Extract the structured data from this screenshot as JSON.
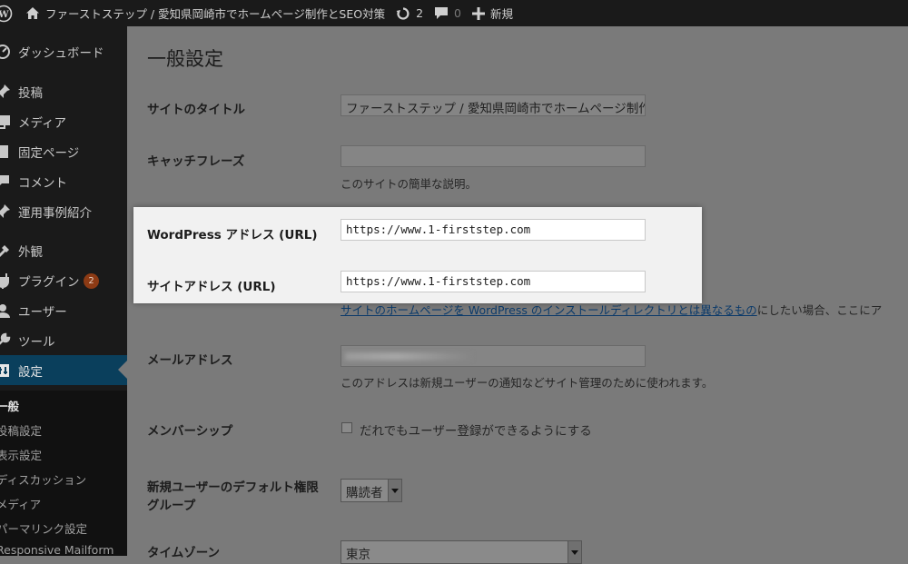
{
  "adminbar": {
    "site_name": "ファーストステップ / 愛知県岡崎市でホームページ制作とSEO対策",
    "updates_count": "2",
    "comments_count": "0",
    "new_label": "新規"
  },
  "sidebar": {
    "items": [
      {
        "label": "ダッシュボード",
        "icon": "dashboard-icon"
      },
      {
        "label": "投稿",
        "icon": "pin-icon"
      },
      {
        "label": "メディア",
        "icon": "media-icon"
      },
      {
        "label": "固定ページ",
        "icon": "page-icon"
      },
      {
        "label": "コメント",
        "icon": "comment-icon"
      },
      {
        "label": "運用事例紹介",
        "icon": "pin-icon"
      },
      {
        "label": "外観",
        "icon": "appearance-icon"
      },
      {
        "label": "プラグイン",
        "icon": "plugin-icon",
        "badge": "2"
      },
      {
        "label": "ユーザー",
        "icon": "user-icon"
      },
      {
        "label": "ツール",
        "icon": "wrench-icon"
      },
      {
        "label": "設定",
        "icon": "settings-icon"
      }
    ],
    "submenu": [
      "一般",
      "投稿設定",
      "表示設定",
      "ディスカッション",
      "メディア",
      "パーマリンク設定",
      "Responsive Mailform"
    ]
  },
  "main": {
    "page_title": "一般設定",
    "site_title_label": "サイトのタイトル",
    "site_title_value": "ファーストステップ / 愛知県岡崎市でホームページ制作",
    "tagline_label": "キャッチフレーズ",
    "tagline_value": "",
    "tagline_desc": "このサイトの簡単な説明。",
    "wp_url_label": "WordPress アドレス (URL)",
    "wp_url_value": "https://www.1-firststep.com",
    "site_url_label": "サイトアドレス (URL)",
    "site_url_value": "https://www.1-firststep.com",
    "site_url_desc_link": "サイトのホームページを WordPress のインストールディレクトリとは異なるもの",
    "site_url_desc_rest": "にしたい場合、ここにア",
    "email_label": "メールアドレス",
    "email_desc": "このアドレスは新規ユーザーの通知などサイト管理のために使われます。",
    "membership_label": "メンバーシップ",
    "membership_checkbox_label": "だれでもユーザー登録ができるようにする",
    "default_role_label_line1": "新規ユーザーのデフォルト権限",
    "default_role_label_line2": "グループ",
    "default_role_value": "購読者",
    "timezone_label": "タイムゾーン",
    "timezone_value": "東京"
  },
  "colors": {
    "adminbar_bg": "#1a1a1a",
    "sidebar_current_bg": "#0a3f5c",
    "badge_bg": "#8c3a14",
    "overlay_bg": "#7a7a7a",
    "highlight_bg": "#f1f1f1"
  }
}
